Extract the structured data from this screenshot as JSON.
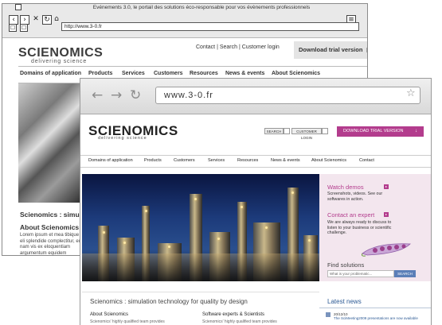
{
  "back_window": {
    "title": "Evénements 3.0, le portail des solutions éco-responsable pour vos évènements professionnels",
    "url": "http://www.3-0.fr",
    "logo": "SCIENOMICS",
    "tagline": "delivering science",
    "top_links": "Contact  |  Search  |  Customer login",
    "download": "Download trial version",
    "nav": [
      "Domains of application",
      "Products",
      "Services",
      "Customers",
      "Resources",
      "News & events",
      "About Scienomics"
    ],
    "heading": "Scienomics : simulation",
    "about_heading": "About Scienomics :",
    "about_body": "Lorem ipsum et mea tibique eli splendide complectitur, eu nam vis ex eloquentiam argumentum equidem perpetua nostrum"
  },
  "front_window": {
    "url": "www.3-0.fr",
    "logo": "SCIENOMICS",
    "tagline": "delivering science",
    "search_label": "SEARCH",
    "login_label": "CUSTOMER LOGIN",
    "download": "DOWNLOAD TRIAL VERSION",
    "nav": [
      "Domains of application",
      "Products",
      "Customers",
      "Services",
      "Resources",
      "News & events",
      "About Scienomics",
      "Contact"
    ],
    "side": {
      "watch_title": "Watch demos",
      "watch_text": "Screenshots, videos. See our softwares in action.",
      "contact_title": "Contact an expert",
      "contact_text": "We are always ready to discuss to listen to your business or scientific challenge.",
      "find_title": "Find solutions",
      "find_placeholder": "What is your problematic...",
      "find_button": "SEARCH"
    },
    "tagline_line": "Scienomics : simulation technology for quality by design",
    "latest_news": "Latest news",
    "news_date": "20/12/10",
    "news_text": "The SciMeeting2009 presentations are now available",
    "about_heading": "About Scienomics",
    "about_sub": "Scienomics' highly qualified team provides",
    "experts_heading": "Software experts & Scientists",
    "experts_sub": "Scienomics' highly qualified team provides"
  },
  "colors": {
    "accent": "#b33c8d",
    "link_blue": "#2e5b95",
    "panel": "#f3e6ee"
  }
}
